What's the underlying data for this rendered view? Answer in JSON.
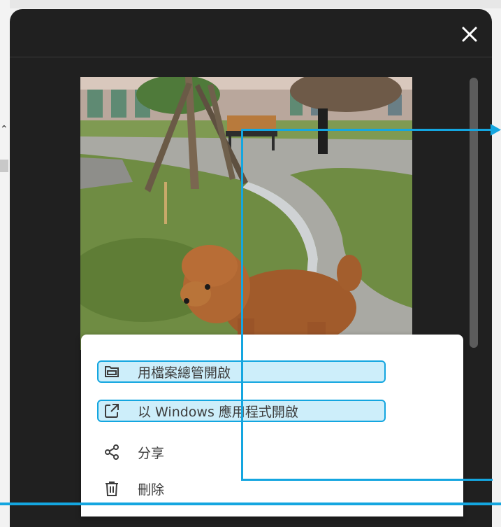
{
  "viewer": {
    "close_label": "✕"
  },
  "menu": {
    "items": [
      {
        "label": "用檔案總管開啟",
        "icon": "folder-icon"
      },
      {
        "label": "以 Windows 應用程式開啟",
        "icon": "open-external-icon"
      },
      {
        "label": "分享",
        "icon": "share-icon"
      },
      {
        "label": "刪除",
        "icon": "trash-icon"
      }
    ]
  },
  "colors": {
    "highlight": "#cdeefa",
    "annotation": "#14a6e0",
    "viewer_bg": "#202020"
  }
}
